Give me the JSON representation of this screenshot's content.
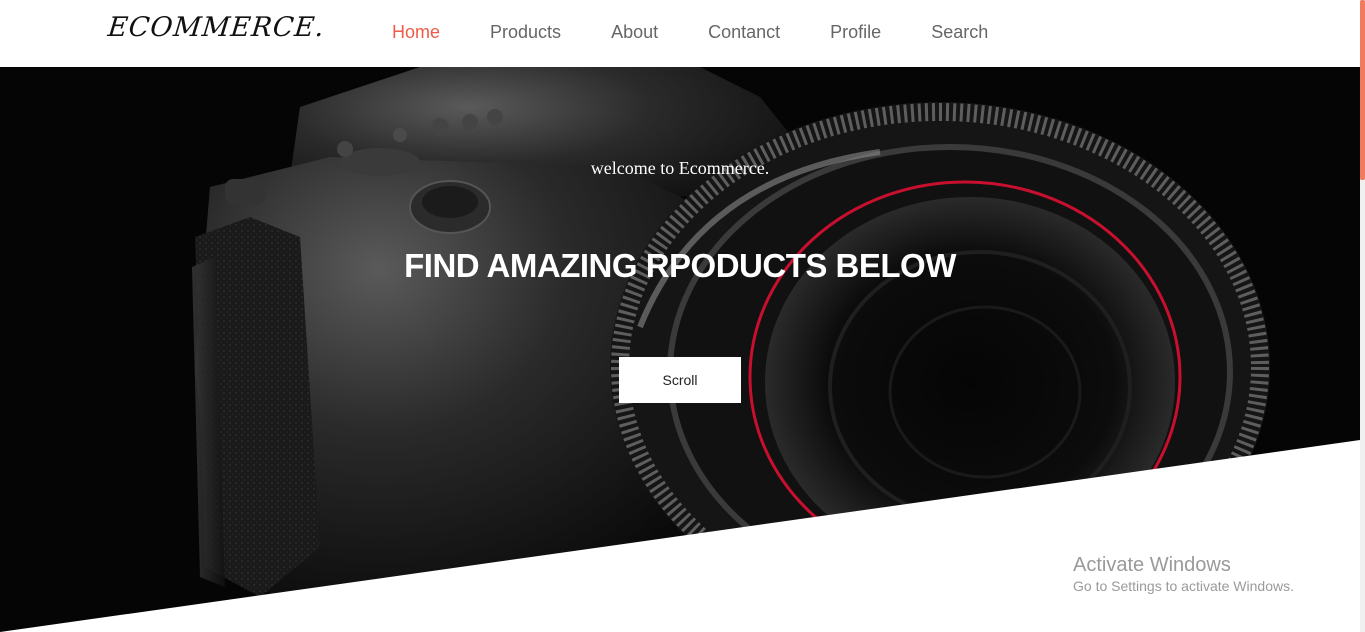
{
  "brand": {
    "logo_text": "ECOMMERCE."
  },
  "nav": {
    "items": [
      {
        "label": "Home",
        "active": true
      },
      {
        "label": "Products",
        "active": false
      },
      {
        "label": "About",
        "active": false
      },
      {
        "label": "Contanct",
        "active": false
      },
      {
        "label": "Profile",
        "active": false
      },
      {
        "label": "Search",
        "active": false
      }
    ]
  },
  "hero": {
    "welcome_text": "welcome to Ecommerce.",
    "headline": "FIND AMAZING RPODUCTS BELOW",
    "scroll_button_label": "Scroll"
  },
  "watermark": {
    "title": "Activate Windows",
    "subtitle": "Go to Settings to activate Windows."
  },
  "colors": {
    "accent": "#f05a48",
    "nav_text": "#666666",
    "hero_background": "#050505",
    "scrollbar_thumb": "#f07b5e"
  }
}
